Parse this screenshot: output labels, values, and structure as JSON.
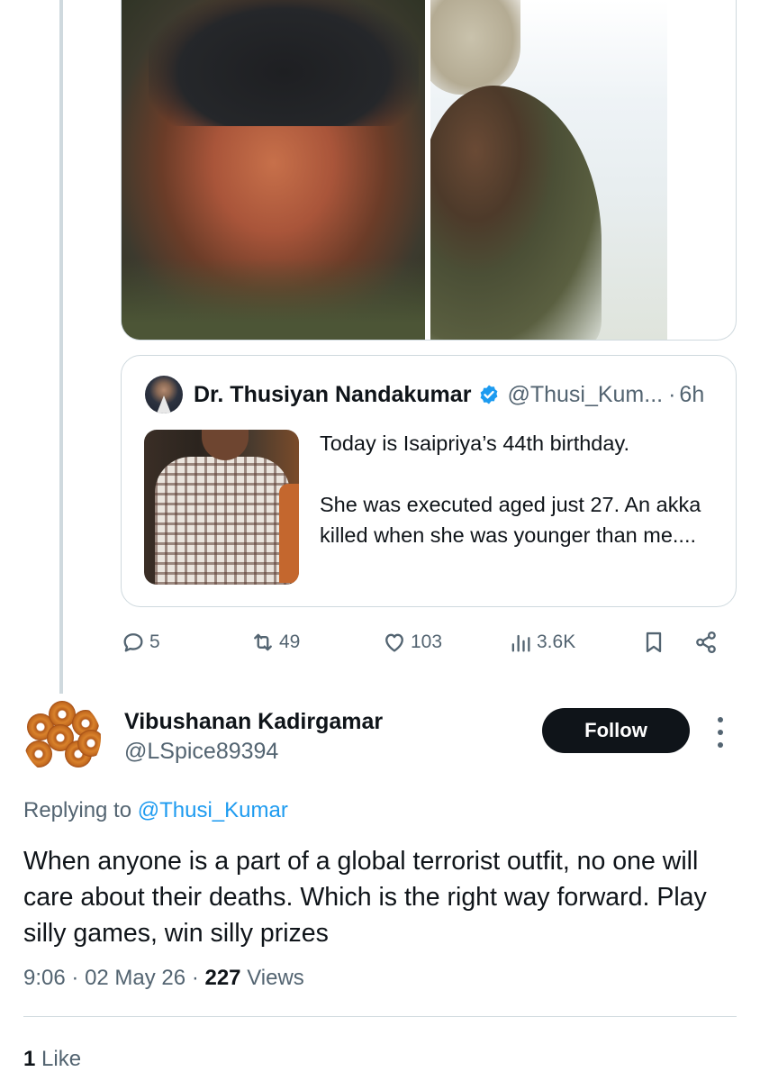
{
  "quoted_tweet": {
    "author_name": "Dr. Thusiyan Nandakumar",
    "author_handle": "@Thusi_Kum...",
    "separator": "·",
    "time": "6h",
    "text_line1": "Today is Isaipriya’s 44th birthday.",
    "text_line2": "She was executed aged just 27. An akka killed when she was younger than me....",
    "verified_color": "#1d9bf0"
  },
  "actions": {
    "replies": "5",
    "reposts": "49",
    "likes": "103",
    "views": "3.6K"
  },
  "reply": {
    "author_name": "Vibushanan Kadirgamar",
    "author_handle": "@LSpice89394",
    "follow_label": "Follow",
    "replying_prefix": "Replying to",
    "replying_handle": "@Thusi_Kumar",
    "text": "When anyone is a part of a global terrorist outfit, no one will care about their deaths. Which is the right way forward. Play silly games, win silly prizes",
    "time": "9:06",
    "dot1": "·",
    "date": "02 May 26",
    "dot2": "·",
    "views_count": "227",
    "views_label": "Views",
    "likes_count": "1",
    "likes_label": "Like"
  },
  "colors": {
    "accent": "#1d9bf0",
    "text_primary": "#0f1419",
    "text_secondary": "#536471",
    "border": "#cfd9de"
  }
}
